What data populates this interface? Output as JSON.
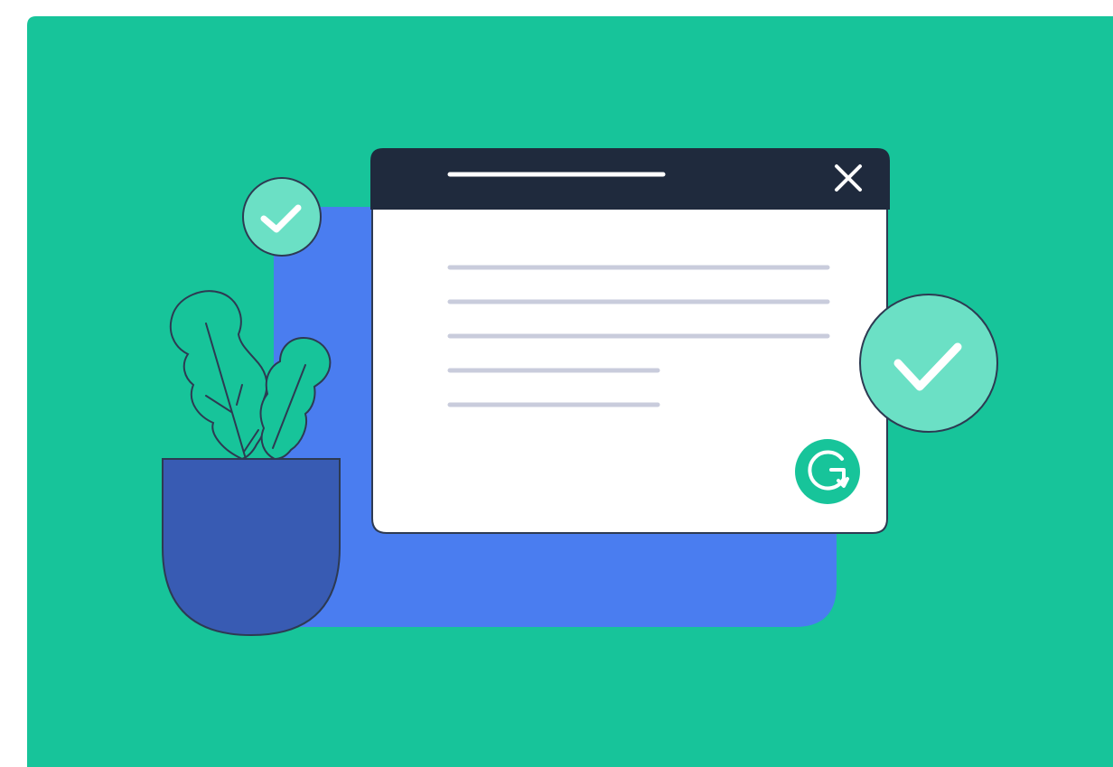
{
  "illustration": {
    "description_icons": [
      "checkmark-icon",
      "close-icon",
      "grammarly-logo-icon",
      "plant-icon"
    ],
    "colors": {
      "background": "#17c49a",
      "blue_card": "#4a7df0",
      "window_header": "#1f2a3d",
      "window_body": "#ffffff",
      "text_lines": "#c9ccdc",
      "check_badge": "#6be0c5",
      "outline": "#2d3a52",
      "pot": "#385bb3",
      "leaf": "#17c49a",
      "logo": "#17c49a"
    }
  }
}
